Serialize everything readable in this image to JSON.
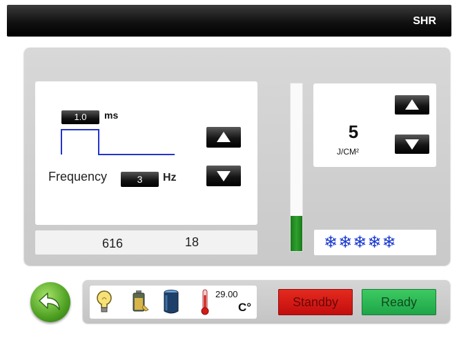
{
  "header": {
    "title": "SHR"
  },
  "pulse": {
    "width_value": "1.0",
    "width_unit": "ms",
    "frequency_label": "Frequency",
    "frequency_value": "3",
    "frequency_unit": "Hz"
  },
  "counters": {
    "shots": "616",
    "secondary": "18"
  },
  "energy_gauge": {
    "level_fraction": 0.21,
    "color": "#1f8a1f"
  },
  "fluence": {
    "value": "5",
    "unit": "J/CM²"
  },
  "cooling": {
    "level": 5,
    "max": 5,
    "color": "#1c3bd0",
    "icon": "snowflake-icon"
  },
  "status": {
    "icons": [
      "lightbulb-icon",
      "battery-icon",
      "water-tank-icon",
      "thermometer-icon"
    ],
    "temperature_value": "29.00",
    "temperature_unit": "C°"
  },
  "buttons": {
    "back_icon": "back-arrow-icon",
    "standby_label": "Standby",
    "ready_label": "Ready",
    "standby_color": "#d41a14",
    "ready_color": "#2bb553"
  }
}
